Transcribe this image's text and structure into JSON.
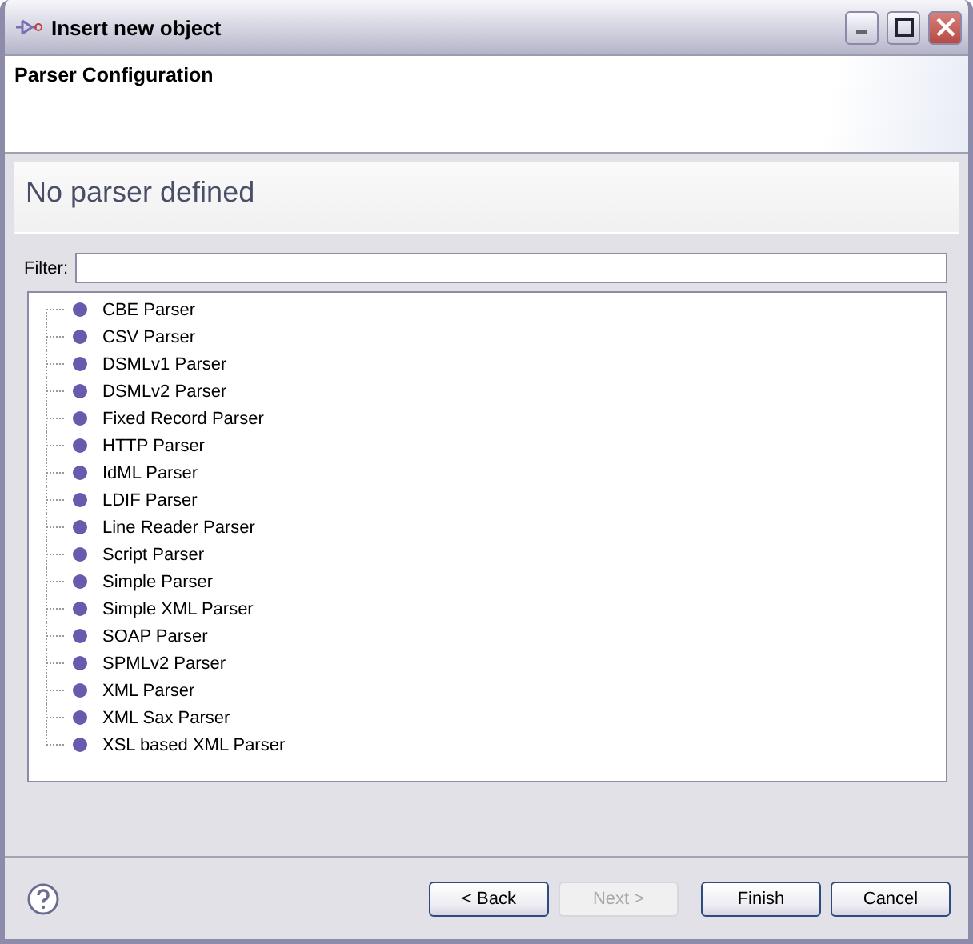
{
  "window": {
    "title": "Insert new object"
  },
  "header": {
    "title": "Parser Configuration"
  },
  "message": "No parser defined",
  "filter": {
    "label": "Filter:"
  },
  "tree": {
    "items": [
      {
        "label": "CBE Parser"
      },
      {
        "label": "CSV Parser"
      },
      {
        "label": "DSMLv1 Parser"
      },
      {
        "label": "DSMLv2 Parser"
      },
      {
        "label": "Fixed Record Parser"
      },
      {
        "label": "HTTP Parser"
      },
      {
        "label": "IdML Parser"
      },
      {
        "label": "LDIF Parser"
      },
      {
        "label": "Line Reader Parser"
      },
      {
        "label": "Script Parser"
      },
      {
        "label": "Simple Parser"
      },
      {
        "label": "Simple XML Parser"
      },
      {
        "label": "SOAP Parser"
      },
      {
        "label": "SPMLv2 Parser"
      },
      {
        "label": "XML Parser"
      },
      {
        "label": "XML Sax Parser"
      },
      {
        "label": "XSL based XML Parser"
      }
    ]
  },
  "buttons": [
    {
      "label": "< Back",
      "disabled": false
    },
    {
      "label": "Next >",
      "disabled": true
    },
    {
      "label": "Finish",
      "disabled": false
    },
    {
      "label": "Cancel",
      "disabled": false
    }
  ]
}
